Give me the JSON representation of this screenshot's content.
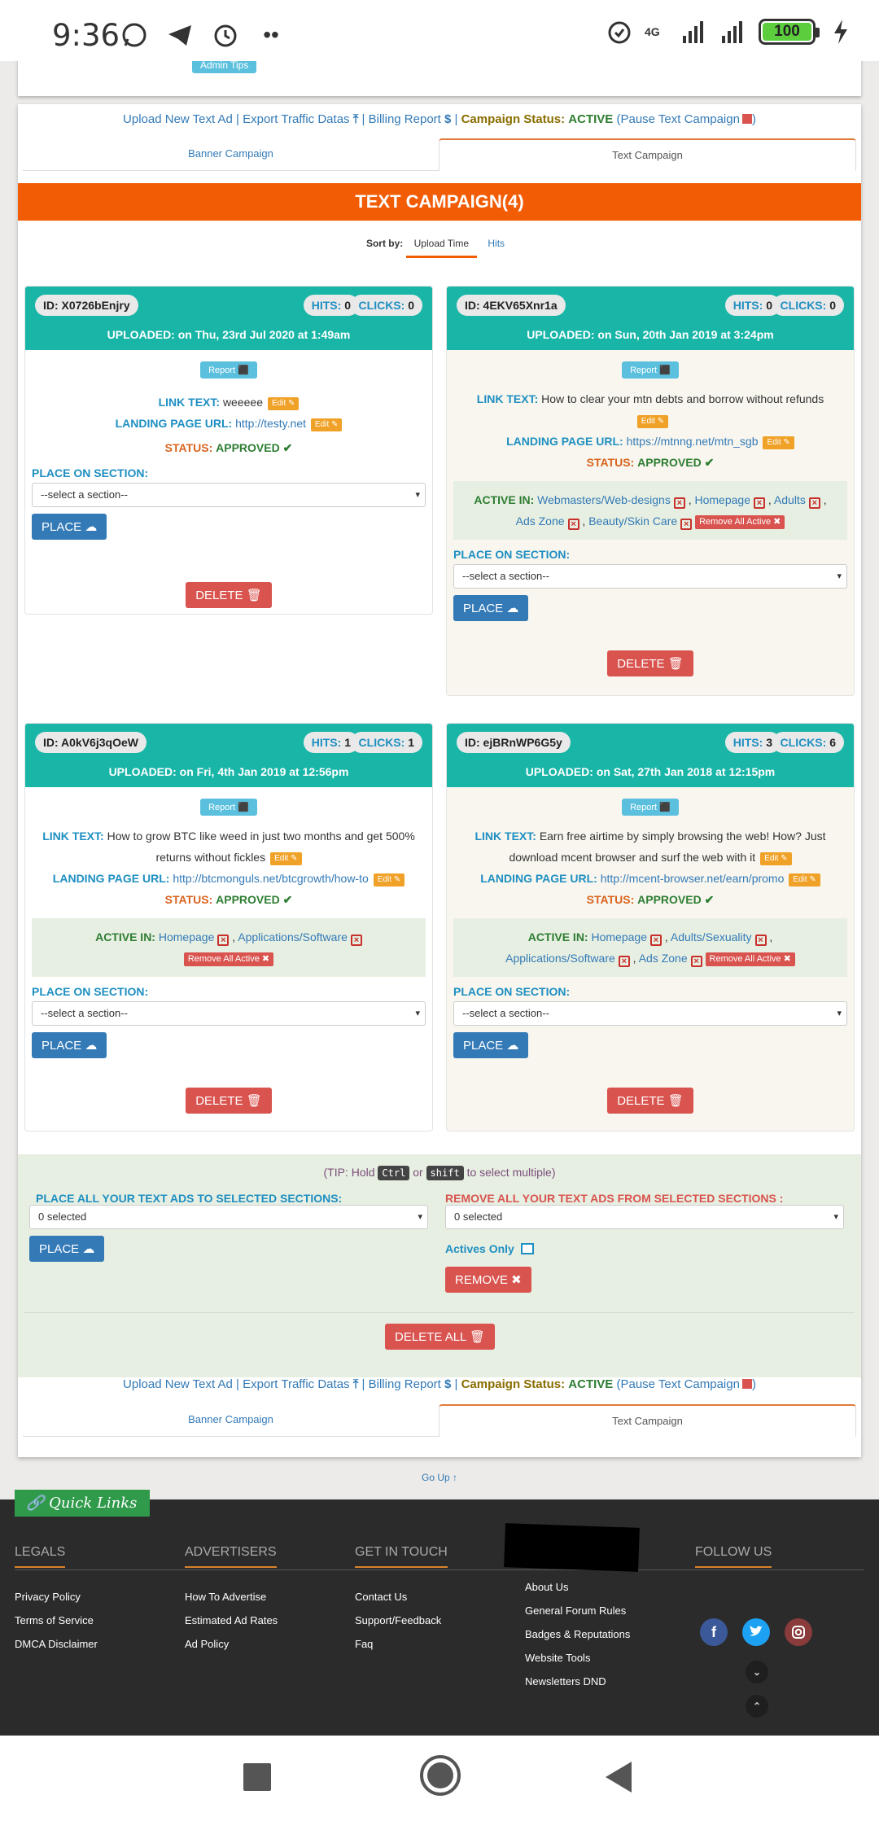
{
  "status_bar": {
    "time": "9:36",
    "network": "4G",
    "battery": "100"
  },
  "admin_tips": "Admin Tips",
  "linkbar": {
    "upload": "Upload New Text Ad",
    "export": "Export Traffic Datas",
    "billing": "Billing Report",
    "campaign_status_label": "Campaign Status:",
    "campaign_status_value": "ACTIVE",
    "pause": "Pause Text Campaign"
  },
  "tabs": {
    "banner": "Banner Campaign",
    "text": "Text Campaign"
  },
  "section_title": "TEXT CAMPAIGN(4)",
  "sort": {
    "label": "Sort by:",
    "selected": "Upload Time",
    "other": "Hits"
  },
  "labels": {
    "report": "Report",
    "link_text": "LINK TEXT:",
    "landing": "LANDING PAGE URL:",
    "status": "STATUS:",
    "edit": "Edit",
    "active_in": "ACTIVE IN:",
    "remove_all_active": "Remove All Active",
    "place_on_section": "PLACE ON SECTION:",
    "select_placeholder": "--select a section--",
    "place": "PLACE",
    "delete": "DELETE",
    "hits": "HITS:",
    "clicks": "CLICKS:"
  },
  "ads": [
    {
      "id": "ID: X0726bEnjry",
      "hits": "0",
      "clicks": "0",
      "uploaded": "UPLOADED: on Thu, 23rd Jul 2020 at 1:49am",
      "link_text": "weeeee",
      "landing_url": "http://testy.net",
      "status": "APPROVED",
      "active_in": []
    },
    {
      "id": "ID: 4EKV65Xnr1a",
      "hits": "0",
      "clicks": "0",
      "uploaded": "UPLOADED: on Sun, 20th Jan 2019 at 3:24pm",
      "link_text": "How to clear your mtn debts and borrow without refunds",
      "landing_url": "https://mtnng.net/mtn_sgb",
      "status": "APPROVED",
      "active_in": [
        "Webmasters/Web-designs",
        "Homepage",
        "Adults",
        "Ads Zone",
        "Beauty/Skin Care"
      ]
    },
    {
      "id": "ID: A0kV6j3qOeW",
      "hits": "1",
      "clicks": "1",
      "uploaded": "UPLOADED: on Fri, 4th Jan 2019 at 12:56pm",
      "link_text": "How to grow BTC like weed in just two months and get 500% returns without fickles",
      "landing_url": "http://btcmonguls.net/btcgrowth/how-to",
      "status": "APPROVED",
      "active_in": [
        "Homepage",
        "Applications/Software"
      ]
    },
    {
      "id": "ID: ejBRnWP6G5y",
      "hits": "3",
      "clicks": "6",
      "uploaded": "UPLOADED: on Sat, 27th Jan 2018 at 12:15pm",
      "link_text": "Earn free airtime by simply browsing the web! How? Just download mcent browser and surf the web with it",
      "landing_url": "http://mcent-browser.net/earn/promo",
      "status": "APPROVED",
      "active_in": [
        "Homepage",
        "Adults/Sexuality",
        "Applications/Software",
        "Ads Zone"
      ]
    }
  ],
  "bulk": {
    "tip_prefix": "(TIP: Hold",
    "tip_key1": "Ctrl",
    "tip_or": "or",
    "tip_key2": "shift",
    "tip_suffix": "to select multiple)",
    "place_all_label": "PLACE ALL YOUR TEXT ADS TO SELECTED SECTIONS:",
    "remove_all_label": "REMOVE ALL YOUR TEXT ADS FROM SELECTED SECTIONS :",
    "selected_value": "0 selected",
    "place": "PLACE",
    "actives_only": "Actives Only",
    "remove": "REMOVE",
    "delete_all": "DELETE ALL"
  },
  "go_up": "Go Up ↑",
  "quick_links": "Quick Links",
  "footer": {
    "legals": {
      "title": "LEGALS",
      "links": [
        "Privacy Policy",
        "Terms of Service",
        "DMCA Disclaimer"
      ]
    },
    "advertisers": {
      "title": "ADVERTISERS",
      "links": [
        "How To Advertise",
        "Estimated Ad Rates",
        "Ad Policy"
      ]
    },
    "get_in_touch": {
      "title": "GET IN TOUCH",
      "links": [
        "Contact Us",
        "Support/Feedback",
        "Faq"
      ]
    },
    "more": {
      "links": [
        "About Us",
        "General Forum Rules",
        "Badges & Reputations",
        "Website Tools",
        "Newsletters DND"
      ]
    },
    "follow": {
      "title": "FOLLOW US"
    }
  },
  "colors": {
    "orange": "#f25c05",
    "teal": "#19b6a8",
    "blue": "#337ab7",
    "red": "#d9534f",
    "green": "#2e7d32"
  }
}
